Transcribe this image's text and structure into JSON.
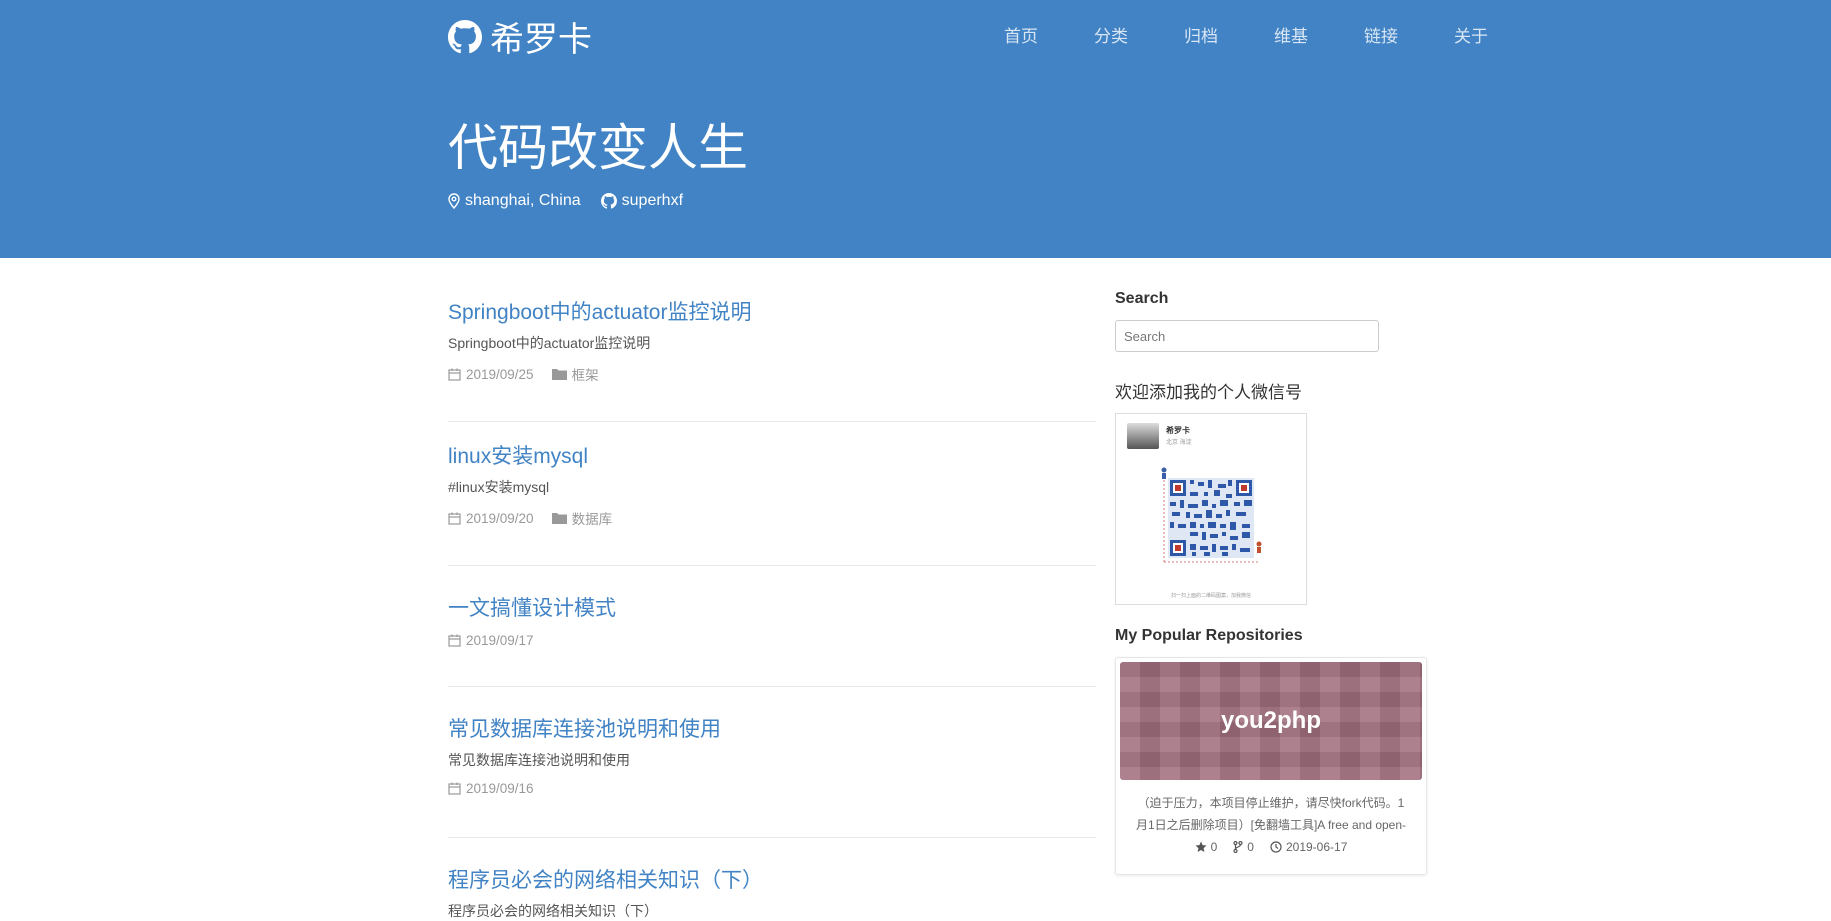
{
  "brand": {
    "name": "希罗卡"
  },
  "nav": [
    "首页",
    "分类",
    "归档",
    "维基",
    "链接",
    "关于"
  ],
  "site": {
    "title": "代码改变人生",
    "location": "shanghai, China",
    "github": "superhxf"
  },
  "posts": [
    {
      "title": "Springboot中的actuator监控说明",
      "excerpt": "Springboot中的actuator监控说明",
      "date": "2019/09/25",
      "category": "框架"
    },
    {
      "title": "linux安装mysql",
      "excerpt": "#linux安装mysql",
      "date": "2019/09/20",
      "category": "数据库"
    },
    {
      "title": "一文搞懂设计模式",
      "excerpt": "",
      "date": "2019/09/17",
      "category": ""
    },
    {
      "title": "常见数据库连接池说明和使用",
      "excerpt": "常见数据库连接池说明和使用",
      "date": "2019/09/16",
      "category": ""
    },
    {
      "title": "程序员必会的网络相关知识（下）",
      "excerpt": "程序员必会的网络相关知识（下）",
      "date": "",
      "category": ""
    }
  ],
  "sidebar": {
    "search_title": "Search",
    "search_placeholder": "Search",
    "wechat_title": "欢迎添加我的个人微信号",
    "qr": {
      "name": "希罗卡",
      "sub": "北京 海淀",
      "caption": "扫一扫上面的二维码图案，加我微信"
    },
    "repos_title": "My Popular Repositories",
    "repo": {
      "name": "you2php",
      "description": "（迫于压力，本项目停止维护，请尽快fork代码。1月1日之后删除项目）[免翻墙工具]A free and open-",
      "stars": "0",
      "forks": "0",
      "updated": "2019-06-17"
    }
  },
  "colors": {
    "header": "#4183c4",
    "link": "#4183c4"
  }
}
